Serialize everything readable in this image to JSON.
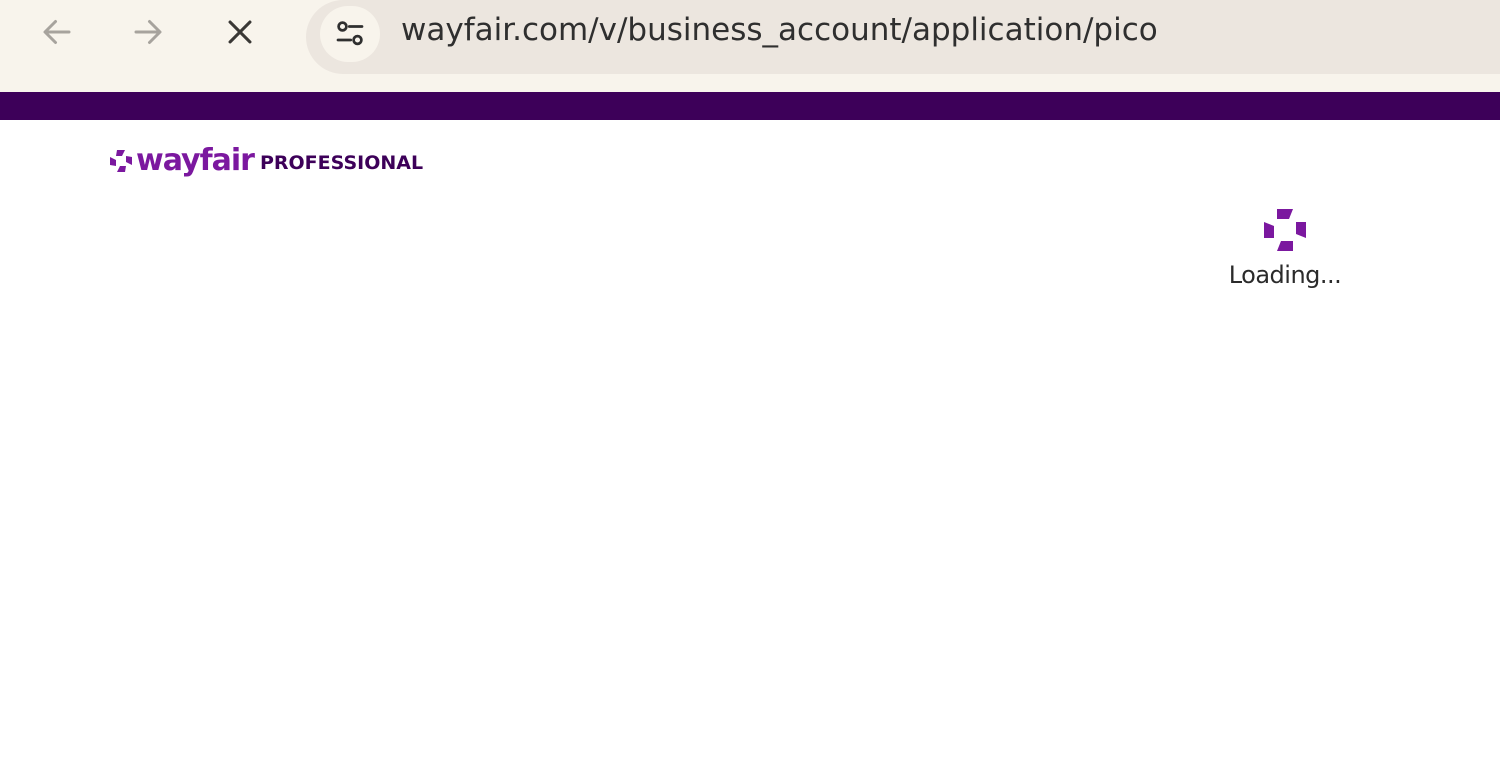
{
  "browser": {
    "url": "wayfair.com/v/business_account/application/pico",
    "icons": {
      "back": "arrow-left-icon",
      "forward": "arrow-right-icon",
      "stop": "close-icon",
      "site_info": "tune-icon"
    }
  },
  "page": {
    "logo": {
      "brand": "wayfair",
      "sub": "PROFESSIONAL"
    },
    "loading_text": "Loading..."
  },
  "colors": {
    "brand_bar": "#3d0059",
    "logo_purple": "#7b189f",
    "logo_dark": "#3d0059",
    "spinner": "#7b189f",
    "toolbar_bg": "#f8f4ec",
    "address_bg": "#ece6df"
  }
}
